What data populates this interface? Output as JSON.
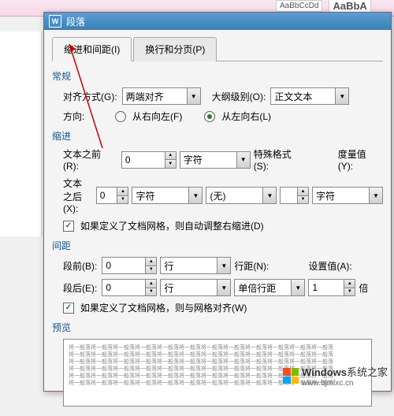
{
  "bg": {
    "style1": "AaBbCcDd",
    "style2": "AaBbA"
  },
  "titlebar": {
    "icon": "W",
    "title": "段落"
  },
  "tabs": {
    "tab1": "缩进和间距(I)",
    "tab2": "换行和分页(P)"
  },
  "general": {
    "title": "常规",
    "align_label": "对齐方式(G):",
    "align_value": "两端对齐",
    "outline_label": "大纲级别(O):",
    "outline_value": "正文文本",
    "direction_label": "方向:",
    "rtl": "从右向左(F)",
    "ltr": "从左向右(L)"
  },
  "indent": {
    "title": "缩进",
    "before_label": "文本之前(R):",
    "before_value": "0",
    "before_unit": "字符",
    "special_label": "特殊格式(S):",
    "measure_label": "度量值(Y):",
    "after_label": "文本之后(X):",
    "after_value": "0",
    "after_unit": "字符",
    "special_value": "(无)",
    "measure_unit": "字符",
    "checkbox": "如果定义了文档网格，则自动调整右缩进(D)"
  },
  "spacing": {
    "title": "间距",
    "before_label": "段前(B):",
    "before_value": "0",
    "before_unit": "行",
    "linespacing_label": "行距(N):",
    "setvalue_label": "设置值(A):",
    "after_label": "段后(E):",
    "after_value": "0",
    "after_unit": "行",
    "linespacing_value": "单倍行距",
    "setvalue_value": "1",
    "setvalue_unit": "倍",
    "checkbox": "如果定义了文档网格，则与网格对齐(W)"
  },
  "preview": {
    "title": "预览",
    "sample": "将一般落将一般落将一般落将一般落将一般落将一般落将一般落将一般落将一般落将一般落将一般落将一般落"
  },
  "watermark": {
    "brand": "Windows",
    "site": "系统之家",
    "url": "www.bjmlxc.cn"
  }
}
